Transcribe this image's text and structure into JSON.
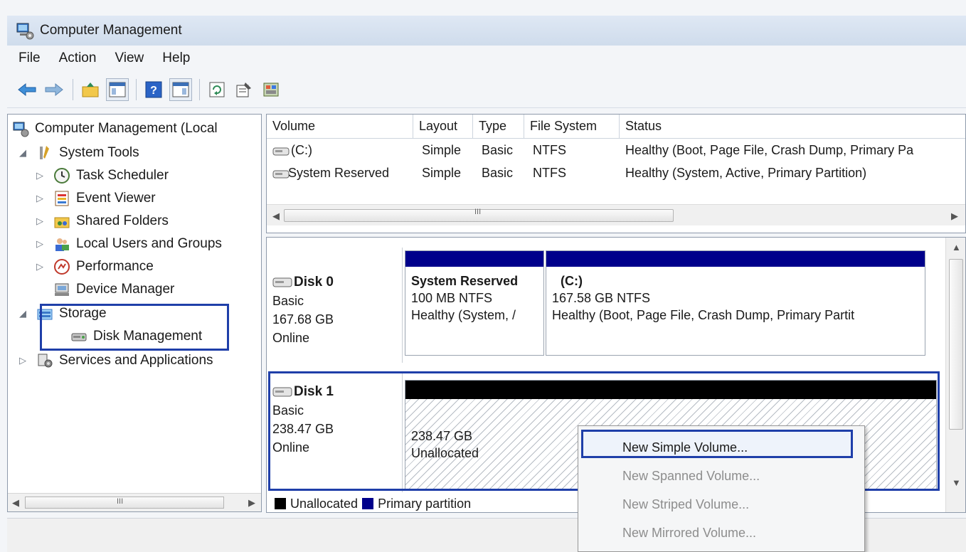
{
  "window": {
    "title": "Computer Management",
    "icon": "computer-management-icon"
  },
  "menubar": {
    "items": [
      "File",
      "Action",
      "View",
      "Help"
    ]
  },
  "toolbar": {
    "icons": [
      "back-arrow-icon",
      "forward-arrow-icon",
      "up-folder-icon",
      "show-hide-console-tree-icon",
      "help-icon",
      "show-hide-action-pane-icon",
      "refresh-icon",
      "properties-icon",
      "disk-settings-icon"
    ]
  },
  "tree": {
    "root": "Computer Management (Local",
    "system_tools": "System Tools",
    "task_scheduler": "Task Scheduler",
    "event_viewer": "Event Viewer",
    "shared_folders": "Shared Folders",
    "local_users": "Local Users and Groups",
    "performance": "Performance",
    "device_manager": "Device Manager",
    "storage": "Storage",
    "disk_management": "Disk Management",
    "services": "Services and Applications",
    "scroll_grip": "III"
  },
  "volumes": {
    "columns": [
      "Volume",
      "Layout",
      "Type",
      "File System",
      "Status"
    ],
    "rows": [
      {
        "volume": "(C:)",
        "layout": "Simple",
        "type": "Basic",
        "fs": "NTFS",
        "status": "Healthy (Boot, Page File, Crash Dump, Primary Pa"
      },
      {
        "volume": "System Reserved",
        "layout": "Simple",
        "type": "Basic",
        "fs": "NTFS",
        "status": "Healthy (System, Active, Primary Partition)"
      }
    ],
    "scroll_grip": "III"
  },
  "disks": [
    {
      "name": "Disk 0",
      "kind": "Basic",
      "size": "167.68 GB",
      "state": "Online",
      "partitions": [
        {
          "title": "System Reserved",
          "detail": "100 MB NTFS",
          "status": "Healthy (System, /"
        },
        {
          "title": "(C:)",
          "detail": "167.58 GB NTFS",
          "status": "Healthy (Boot, Page File, Crash Dump, Primary Partit"
        }
      ]
    },
    {
      "name": "Disk 1",
      "kind": "Basic",
      "size": "238.47 GB",
      "state": "Online",
      "partitions": [
        {
          "detail": "238.47 GB",
          "status": "Unallocated"
        }
      ]
    }
  ],
  "legend": {
    "unallocated": "Unallocated",
    "primary": "Primary partition"
  },
  "context_menu": {
    "items": [
      {
        "label": "New Simple Volume...",
        "enabled": true
      },
      {
        "label": "New Spanned Volume...",
        "enabled": false
      },
      {
        "label": "New Striped Volume...",
        "enabled": false
      },
      {
        "label": "New Mirrored Volume...",
        "enabled": false
      }
    ]
  },
  "colors": {
    "primary_partition": "#00008b",
    "unallocated": "#000000",
    "highlight_box": "#1f3fa9"
  }
}
